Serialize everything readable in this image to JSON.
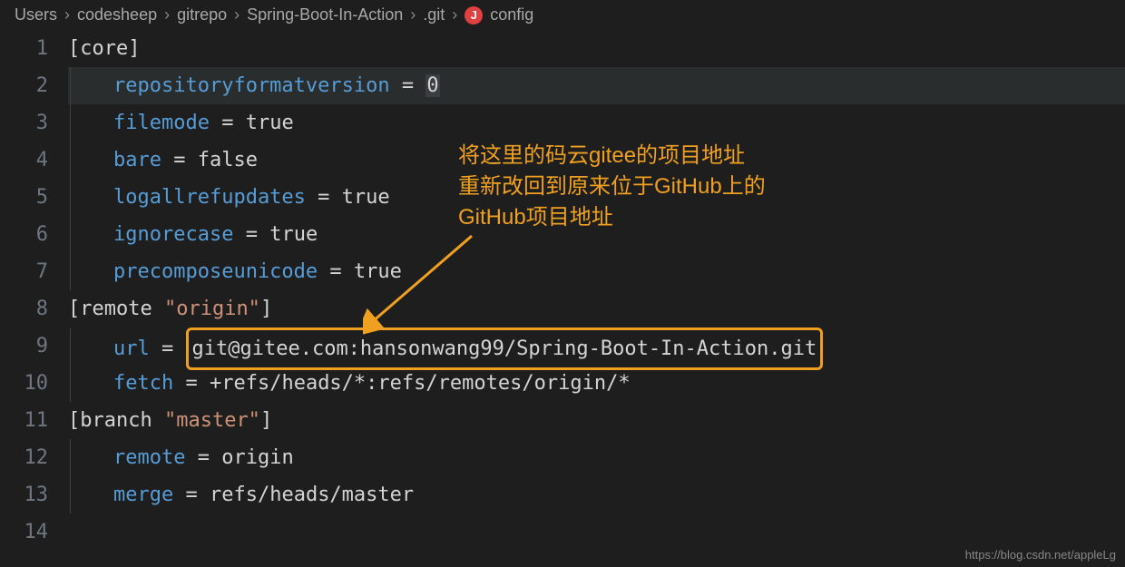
{
  "breadcrumb": {
    "items": [
      "Users",
      "codesheep",
      "gitrepo",
      "Spring-Boot-In-Action",
      ".git",
      "config"
    ],
    "separator": "›",
    "icon_label": "J"
  },
  "code": {
    "lines": [
      {
        "n": "1",
        "section_open": "[",
        "section_name": "core",
        "section_close": "]"
      },
      {
        "n": "2",
        "key": "repositoryformatversion",
        "eq": " = ",
        "value": "0",
        "highlighted": true
      },
      {
        "n": "3",
        "key": "filemode",
        "eq": " = ",
        "value": "true"
      },
      {
        "n": "4",
        "key": "bare",
        "eq": " = ",
        "value": "false"
      },
      {
        "n": "5",
        "key": "logallrefupdates",
        "eq": " = ",
        "value": "true"
      },
      {
        "n": "6",
        "key": "ignorecase",
        "eq": " = ",
        "value": "true"
      },
      {
        "n": "7",
        "key": "precomposeunicode",
        "eq": " = ",
        "value": "true"
      },
      {
        "n": "8",
        "section_open": "[",
        "section_name": "remote ",
        "section_quote": "\"origin\"",
        "section_close": "]"
      },
      {
        "n": "9",
        "key": "url",
        "eq": " = ",
        "value": "git@gitee.com:hansonwang99/Spring-Boot-In-Action.git",
        "boxed": true
      },
      {
        "n": "10",
        "key": "fetch",
        "eq": " = ",
        "value": "+refs/heads/*:refs/remotes/origin/*"
      },
      {
        "n": "11",
        "section_open": "[",
        "section_name": "branch ",
        "section_quote": "\"master\"",
        "section_close": "]"
      },
      {
        "n": "12",
        "key": "remote",
        "eq": " = ",
        "value": "origin"
      },
      {
        "n": "13",
        "key": "merge",
        "eq": " = ",
        "value": "refs/heads/master"
      },
      {
        "n": "14"
      }
    ]
  },
  "annotation": {
    "line1": "将这里的码云gitee的项目地址",
    "line2": "重新改回到原来位于GitHub上的",
    "line3": "GitHub项目地址"
  },
  "watermark": "https://blog.csdn.net/appleLg"
}
